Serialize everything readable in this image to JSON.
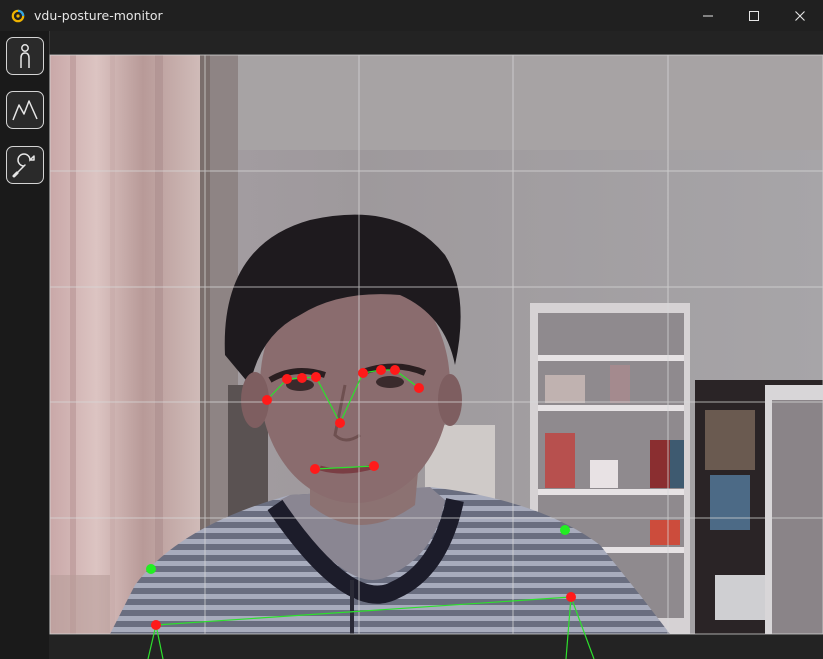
{
  "window": {
    "title": "vdu-posture-monitor",
    "app_icon": "posture-app-icon"
  },
  "window_controls": [
    {
      "name": "minimize-button",
      "icon": "minimize-icon"
    },
    {
      "name": "maximize-button",
      "icon": "maximize-icon"
    },
    {
      "name": "close-button",
      "icon": "close-icon"
    }
  ],
  "sidebar": {
    "items": [
      {
        "name": "posture-view",
        "icon": "person-icon"
      },
      {
        "name": "statistics-view",
        "icon": "line-chart-icon"
      },
      {
        "name": "settings-view",
        "icon": "wrench-icon"
      }
    ]
  },
  "camera": {
    "feed": "webcam-feed",
    "grid": "on",
    "landmark_colors": {
      "face": "#ff1a1a",
      "visibility_ok": "#22ee22",
      "connection": "#2de02d"
    }
  }
}
